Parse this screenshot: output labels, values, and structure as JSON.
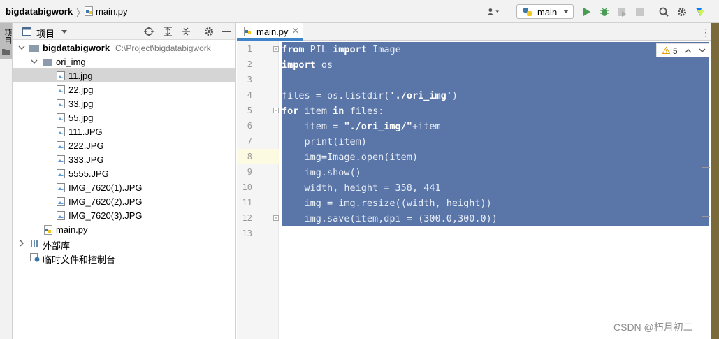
{
  "topbar": {
    "project_name": "bigdatabigwork",
    "file_name": "main.py",
    "run_config": "main"
  },
  "sidebar_strip": {
    "project_tab": "项目"
  },
  "project_panel": {
    "title": "项目",
    "tree": [
      {
        "label": "bigdatabigwork",
        "path": "C:\\Project\\bigdatabigwork",
        "type": "folder",
        "expanded": true
      },
      {
        "label": "ori_img",
        "type": "folder",
        "expanded": true
      },
      {
        "label": "11.jpg",
        "type": "image",
        "selected": true
      },
      {
        "label": "22.jpg",
        "type": "image"
      },
      {
        "label": "33.jpg",
        "type": "image"
      },
      {
        "label": "55.jpg",
        "type": "image"
      },
      {
        "label": "111.JPG",
        "type": "image"
      },
      {
        "label": "222.JPG",
        "type": "image"
      },
      {
        "label": "333.JPG",
        "type": "image"
      },
      {
        "label": "5555.JPG",
        "type": "image"
      },
      {
        "label": "IMG_7620(1).JPG",
        "type": "image"
      },
      {
        "label": "IMG_7620(2).JPG",
        "type": "image"
      },
      {
        "label": "IMG_7620(3).JPG",
        "type": "image"
      },
      {
        "label": "main.py",
        "type": "python"
      },
      {
        "label": "外部库",
        "type": "library"
      },
      {
        "label": "临时文件和控制台",
        "type": "scratch"
      }
    ]
  },
  "editor": {
    "tab_label": "main.py",
    "warning_count": "5",
    "line_numbers": [
      "1",
      "2",
      "3",
      "4",
      "5",
      "6",
      "7",
      "8",
      "9",
      "10",
      "11",
      "12",
      "13"
    ],
    "code": [
      "from PIL import Image",
      "import os",
      "",
      "files = os.listdir('./ori_img')",
      "for item in files:",
      "    item = \"./ori_img/\"+item",
      "    print(item)",
      "    img=Image.open(item)",
      "    img.show()",
      "    width, height = 358, 441",
      "    img = img.resize((width, height))",
      "    img.save(item,dpi = (300.0,300.0))",
      ""
    ]
  },
  "watermark": "CSDN @朽月初二",
  "colors": {
    "selection": "#5a76a9",
    "accent": "#4083c9"
  }
}
